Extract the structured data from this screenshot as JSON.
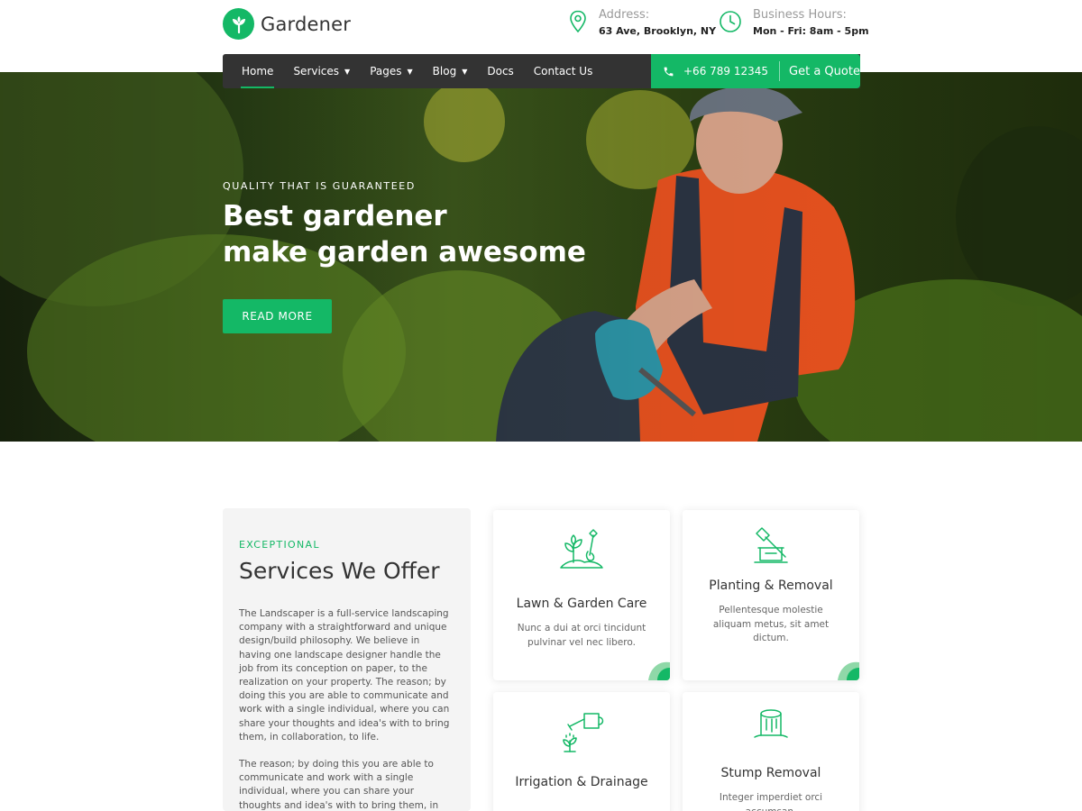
{
  "brand": {
    "name": "Gardener",
    "accent": "#14b866",
    "dark": "#333333"
  },
  "header": {
    "address": {
      "label": "Address:",
      "value": "63 Ave, Brooklyn, NY",
      "icon": "map-pin-icon"
    },
    "hours": {
      "label": "Business Hours:",
      "value": "Mon - Fri: 8am - 5pm",
      "icon": "clock-icon"
    }
  },
  "nav": {
    "items": [
      {
        "label": "Home",
        "active": true,
        "dropdown": false
      },
      {
        "label": "Services",
        "dropdown": true
      },
      {
        "label": "Pages",
        "dropdown": true
      },
      {
        "label": "Blog",
        "dropdown": true
      },
      {
        "label": "Docs",
        "dropdown": false
      },
      {
        "label": "Contact Us",
        "dropdown": false
      }
    ],
    "phone": "+66 789 12345",
    "quote": "Get a Quote"
  },
  "hero": {
    "kicker": "QUALITY THAT IS GUARANTEED",
    "title_line1": "Best gardener",
    "title_line2": "make garden awesome",
    "button": "READ MORE"
  },
  "services": {
    "kicker": "EXCEPTIONAL",
    "title": "Services We Offer",
    "para1": "The Landscaper is a full-service landscaping company with a straightforward and unique design/build philosophy. We believe in having one landscape designer handle the job from its conception on paper, to the realization on your property. The reason; by doing this you are able to communicate and work with a single individual, where you can share your thoughts and idea's with to bring them, in collaboration, to life.",
    "para2": "The reason; by doing this you are able to communicate and work with a single individual, where you can share your thoughts and idea's with to bring them, in",
    "cards": [
      {
        "title": "Lawn & Garden Care",
        "text": "Nunc a dui at orci tincidunt pulvinar vel nec libero.",
        "icon": "shovel-plant-icon"
      },
      {
        "title": "Planting & Removal",
        "text": "Pellentesque molestie aliquam metus, sit amet dictum.",
        "icon": "axe-stump-icon"
      },
      {
        "title": "Irrigation & Drainage",
        "text": "",
        "icon": "watering-can-icon"
      },
      {
        "title": "Stump Removal",
        "text": "Integer imperdiet orci accumsan.",
        "icon": "tree-stump-icon"
      }
    ]
  }
}
